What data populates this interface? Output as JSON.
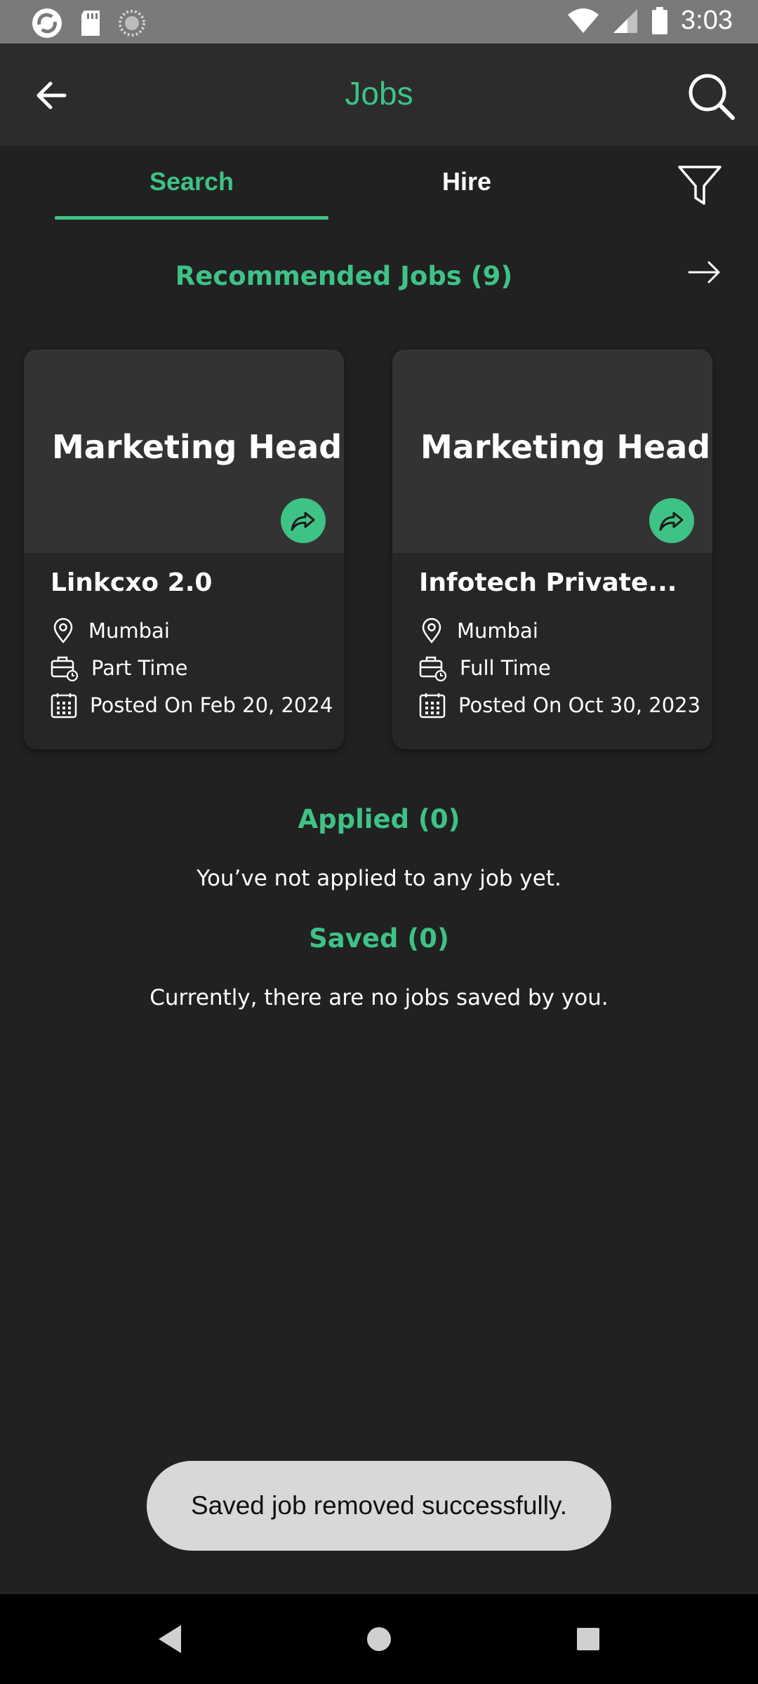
{
  "status_bar": {
    "time": "3:03"
  },
  "app_bar": {
    "title": "Jobs"
  },
  "tabs": [
    {
      "label": "Search"
    },
    {
      "label": "Hire"
    }
  ],
  "recommended": {
    "heading": "Recommended Jobs (9)",
    "cards": [
      {
        "role": "Marketing Head",
        "company": "Linkcxo 2.0",
        "location": "Mumbai",
        "type": "Part Time",
        "posted": "Posted On Feb 20, 2024"
      },
      {
        "role": "Marketing Head",
        "company": "Infotech Private...",
        "location": "Mumbai",
        "type": "Full Time",
        "posted": "Posted On Oct 30, 2023"
      }
    ]
  },
  "applied": {
    "heading": "Applied (0)",
    "message": "You’ve not applied to any job yet."
  },
  "saved": {
    "heading": "Saved (0)",
    "message": "Currently, there are no jobs saved by you."
  },
  "toast": {
    "message": "Saved job removed successfully."
  },
  "colors": {
    "accent": "#3ec286",
    "background": "#212121",
    "appbar": "#2c2c2c",
    "card_top": "#333333"
  },
  "icons": [
    "back-arrow-icon",
    "search-icon",
    "filter-icon",
    "arrow-right-icon",
    "share-icon",
    "location-pin-icon",
    "briefcase-clock-icon",
    "calendar-icon"
  ]
}
